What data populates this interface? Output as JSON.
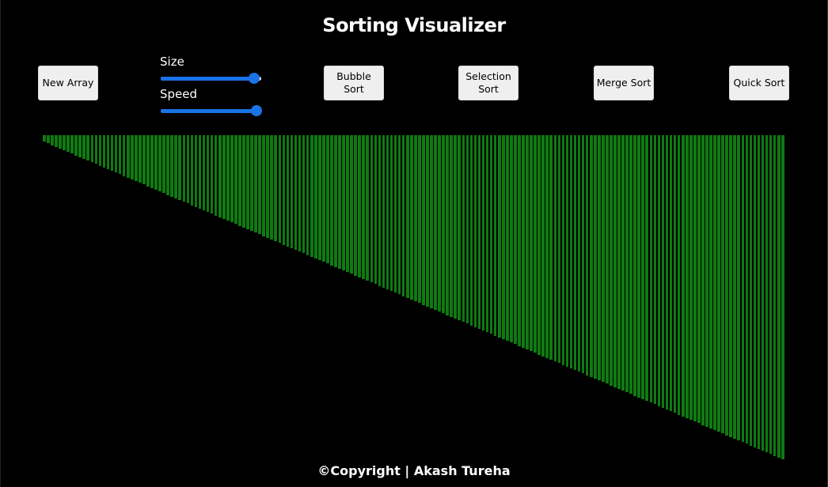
{
  "app": {
    "title": "Sorting Visualizer"
  },
  "toolbar": {
    "new_array_label": "New Array",
    "size_label": "Size",
    "size_value_fraction": 0.93,
    "speed_label": "Speed",
    "speed_value_fraction": 1.0,
    "bubble_sort_label": "Bubble Sort",
    "selection_sort_label": "Selection Sort",
    "merge_sort_label": "Merge Sort",
    "quick_sort_label": "Quick Sort"
  },
  "visualizer": {
    "bar_color": "#0f7a12",
    "bar_count": 186,
    "min_value": 2,
    "max_value": 100
  },
  "footer": {
    "text": "©Copyright | Akash Tureha"
  },
  "colors": {
    "background": "#000000",
    "accent": "#1a73e8",
    "button_bg": "#efefef"
  }
}
